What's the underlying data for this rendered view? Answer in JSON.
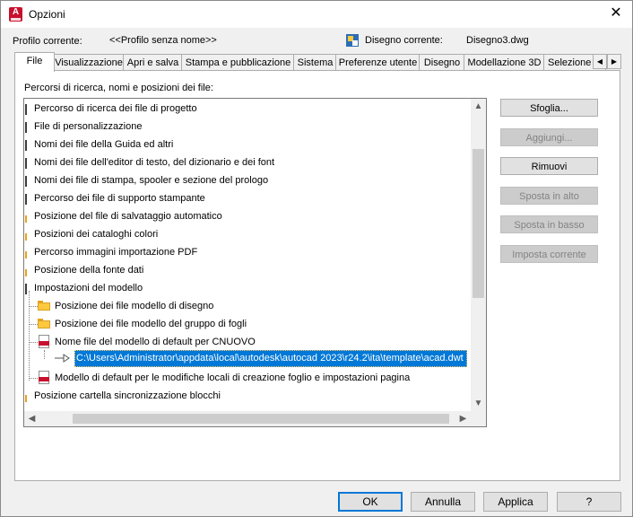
{
  "window": {
    "title": "Opzioni",
    "close_glyph": "✕",
    "app_icon_letter": "A"
  },
  "profile": {
    "label": "Profilo corrente:",
    "value": "<<Profilo senza nome>>",
    "drawing_label": "Disegno corrente:",
    "drawing_value": "Disegno3.dwg"
  },
  "tabs": [
    "File",
    "Visualizzazione",
    "Apri e salva",
    "Stampa e pubblicazione",
    "Sistema",
    "Preferenze utente",
    "Disegno",
    "Modellazione 3D",
    "Selezione"
  ],
  "active_tab": "File",
  "section_label": "Percorsi di ricerca, nomi e posizioni dei file:",
  "tree": {
    "items": [
      "Percorso di ricerca dei file di progetto",
      "File di personalizzazione",
      "Nomi dei file della Guida ed altri",
      "Nomi dei file dell'editor di testo, del dizionario e dei font",
      "Nomi dei file di stampa, spooler e sezione del prologo",
      "Percorso dei file di supporto stampante",
      "Posizione del file di salvataggio automatico",
      "Posizioni dei cataloghi colori",
      "Percorso immagini importazione PDF",
      "Posizione della fonte dati",
      "Impostazioni del modello"
    ],
    "children": [
      "Posizione dei file modello di disegno",
      "Posizione dei file modello del gruppo di fogli",
      "Nome file del modello di default per CNUOVO"
    ],
    "selected_path": "C:\\Users\\Administrator\\appdata\\local\\autodesk\\autocad 2023\\r24.2\\ita\\template\\acad.dwt",
    "after_children": [
      "Modello di default per le modifiche locali di creazione foglio e impostazioni pagina"
    ],
    "last_item": "Posizione cartella sincronizzazione blocchi",
    "scroll": {
      "up": "▲",
      "down": "▼",
      "left": "◀",
      "right": "▶"
    }
  },
  "side_buttons": {
    "browse": "Sfoglia...",
    "add": "Aggiungi...",
    "remove": "Rimuovi",
    "move_up": "Sposta in alto",
    "move_down": "Sposta in basso",
    "set_current": "Imposta corrente"
  },
  "footer": {
    "ok": "OK",
    "cancel": "Annulla",
    "apply": "Applica",
    "help": "?"
  },
  "tab_scroll": {
    "left": "◀",
    "right": "▶"
  },
  "colors": {
    "selection": "#0078d7",
    "folder": "#ffc83d",
    "accent_red": "#c8102e"
  }
}
